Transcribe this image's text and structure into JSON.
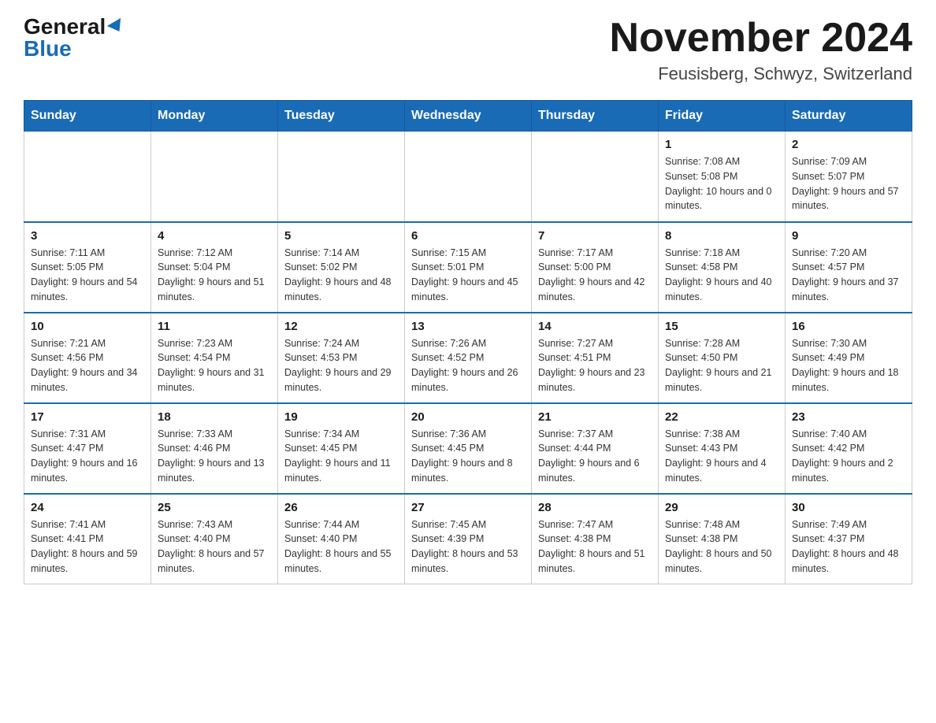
{
  "header": {
    "logo_general": "General",
    "logo_blue": "Blue",
    "month_title": "November 2024",
    "location": "Feusisberg, Schwyz, Switzerland"
  },
  "weekdays": [
    "Sunday",
    "Monday",
    "Tuesday",
    "Wednesday",
    "Thursday",
    "Friday",
    "Saturday"
  ],
  "weeks": [
    [
      {
        "day": "",
        "sunrise": "",
        "sunset": "",
        "daylight": ""
      },
      {
        "day": "",
        "sunrise": "",
        "sunset": "",
        "daylight": ""
      },
      {
        "day": "",
        "sunrise": "",
        "sunset": "",
        "daylight": ""
      },
      {
        "day": "",
        "sunrise": "",
        "sunset": "",
        "daylight": ""
      },
      {
        "day": "",
        "sunrise": "",
        "sunset": "",
        "daylight": ""
      },
      {
        "day": "1",
        "sunrise": "Sunrise: 7:08 AM",
        "sunset": "Sunset: 5:08 PM",
        "daylight": "Daylight: 10 hours and 0 minutes."
      },
      {
        "day": "2",
        "sunrise": "Sunrise: 7:09 AM",
        "sunset": "Sunset: 5:07 PM",
        "daylight": "Daylight: 9 hours and 57 minutes."
      }
    ],
    [
      {
        "day": "3",
        "sunrise": "Sunrise: 7:11 AM",
        "sunset": "Sunset: 5:05 PM",
        "daylight": "Daylight: 9 hours and 54 minutes."
      },
      {
        "day": "4",
        "sunrise": "Sunrise: 7:12 AM",
        "sunset": "Sunset: 5:04 PM",
        "daylight": "Daylight: 9 hours and 51 minutes."
      },
      {
        "day": "5",
        "sunrise": "Sunrise: 7:14 AM",
        "sunset": "Sunset: 5:02 PM",
        "daylight": "Daylight: 9 hours and 48 minutes."
      },
      {
        "day": "6",
        "sunrise": "Sunrise: 7:15 AM",
        "sunset": "Sunset: 5:01 PM",
        "daylight": "Daylight: 9 hours and 45 minutes."
      },
      {
        "day": "7",
        "sunrise": "Sunrise: 7:17 AM",
        "sunset": "Sunset: 5:00 PM",
        "daylight": "Daylight: 9 hours and 42 minutes."
      },
      {
        "day": "8",
        "sunrise": "Sunrise: 7:18 AM",
        "sunset": "Sunset: 4:58 PM",
        "daylight": "Daylight: 9 hours and 40 minutes."
      },
      {
        "day": "9",
        "sunrise": "Sunrise: 7:20 AM",
        "sunset": "Sunset: 4:57 PM",
        "daylight": "Daylight: 9 hours and 37 minutes."
      }
    ],
    [
      {
        "day": "10",
        "sunrise": "Sunrise: 7:21 AM",
        "sunset": "Sunset: 4:56 PM",
        "daylight": "Daylight: 9 hours and 34 minutes."
      },
      {
        "day": "11",
        "sunrise": "Sunrise: 7:23 AM",
        "sunset": "Sunset: 4:54 PM",
        "daylight": "Daylight: 9 hours and 31 minutes."
      },
      {
        "day": "12",
        "sunrise": "Sunrise: 7:24 AM",
        "sunset": "Sunset: 4:53 PM",
        "daylight": "Daylight: 9 hours and 29 minutes."
      },
      {
        "day": "13",
        "sunrise": "Sunrise: 7:26 AM",
        "sunset": "Sunset: 4:52 PM",
        "daylight": "Daylight: 9 hours and 26 minutes."
      },
      {
        "day": "14",
        "sunrise": "Sunrise: 7:27 AM",
        "sunset": "Sunset: 4:51 PM",
        "daylight": "Daylight: 9 hours and 23 minutes."
      },
      {
        "day": "15",
        "sunrise": "Sunrise: 7:28 AM",
        "sunset": "Sunset: 4:50 PM",
        "daylight": "Daylight: 9 hours and 21 minutes."
      },
      {
        "day": "16",
        "sunrise": "Sunrise: 7:30 AM",
        "sunset": "Sunset: 4:49 PM",
        "daylight": "Daylight: 9 hours and 18 minutes."
      }
    ],
    [
      {
        "day": "17",
        "sunrise": "Sunrise: 7:31 AM",
        "sunset": "Sunset: 4:47 PM",
        "daylight": "Daylight: 9 hours and 16 minutes."
      },
      {
        "day": "18",
        "sunrise": "Sunrise: 7:33 AM",
        "sunset": "Sunset: 4:46 PM",
        "daylight": "Daylight: 9 hours and 13 minutes."
      },
      {
        "day": "19",
        "sunrise": "Sunrise: 7:34 AM",
        "sunset": "Sunset: 4:45 PM",
        "daylight": "Daylight: 9 hours and 11 minutes."
      },
      {
        "day": "20",
        "sunrise": "Sunrise: 7:36 AM",
        "sunset": "Sunset: 4:45 PM",
        "daylight": "Daylight: 9 hours and 8 minutes."
      },
      {
        "day": "21",
        "sunrise": "Sunrise: 7:37 AM",
        "sunset": "Sunset: 4:44 PM",
        "daylight": "Daylight: 9 hours and 6 minutes."
      },
      {
        "day": "22",
        "sunrise": "Sunrise: 7:38 AM",
        "sunset": "Sunset: 4:43 PM",
        "daylight": "Daylight: 9 hours and 4 minutes."
      },
      {
        "day": "23",
        "sunrise": "Sunrise: 7:40 AM",
        "sunset": "Sunset: 4:42 PM",
        "daylight": "Daylight: 9 hours and 2 minutes."
      }
    ],
    [
      {
        "day": "24",
        "sunrise": "Sunrise: 7:41 AM",
        "sunset": "Sunset: 4:41 PM",
        "daylight": "Daylight: 8 hours and 59 minutes."
      },
      {
        "day": "25",
        "sunrise": "Sunrise: 7:43 AM",
        "sunset": "Sunset: 4:40 PM",
        "daylight": "Daylight: 8 hours and 57 minutes."
      },
      {
        "day": "26",
        "sunrise": "Sunrise: 7:44 AM",
        "sunset": "Sunset: 4:40 PM",
        "daylight": "Daylight: 8 hours and 55 minutes."
      },
      {
        "day": "27",
        "sunrise": "Sunrise: 7:45 AM",
        "sunset": "Sunset: 4:39 PM",
        "daylight": "Daylight: 8 hours and 53 minutes."
      },
      {
        "day": "28",
        "sunrise": "Sunrise: 7:47 AM",
        "sunset": "Sunset: 4:38 PM",
        "daylight": "Daylight: 8 hours and 51 minutes."
      },
      {
        "day": "29",
        "sunrise": "Sunrise: 7:48 AM",
        "sunset": "Sunset: 4:38 PM",
        "daylight": "Daylight: 8 hours and 50 minutes."
      },
      {
        "day": "30",
        "sunrise": "Sunrise: 7:49 AM",
        "sunset": "Sunset: 4:37 PM",
        "daylight": "Daylight: 8 hours and 48 minutes."
      }
    ]
  ]
}
